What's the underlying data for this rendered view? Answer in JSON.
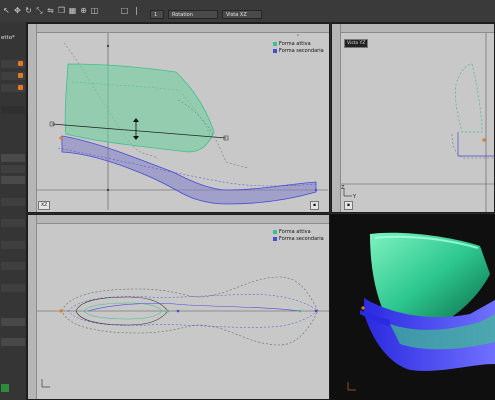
{
  "toolbar": {
    "rotation_label": "Rotation",
    "view_label": "Vista XZ",
    "icons": [
      "arrow-icon",
      "move-icon",
      "rotate-icon",
      "scale-icon",
      "mirror-icon",
      "copy-icon",
      "grid-icon",
      "snap-icon",
      "measure-icon",
      "zoom-icon"
    ]
  },
  "sidebar": {
    "title": "etto*"
  },
  "viewports": {
    "side": {
      "legend_primary": "Forma attiva",
      "legend_secondary": "Forma secondaria",
      "tag": "XZ"
    },
    "front": {
      "view_name": "Vista YZ"
    },
    "top": {
      "legend_primary": "Forma attiva",
      "legend_secondary": "Forma secondaria"
    }
  },
  "colors": {
    "active_shape": "#3fbf8f",
    "secondary_shape": "#4a4ad8",
    "axis_orange": "#e07a22"
  }
}
